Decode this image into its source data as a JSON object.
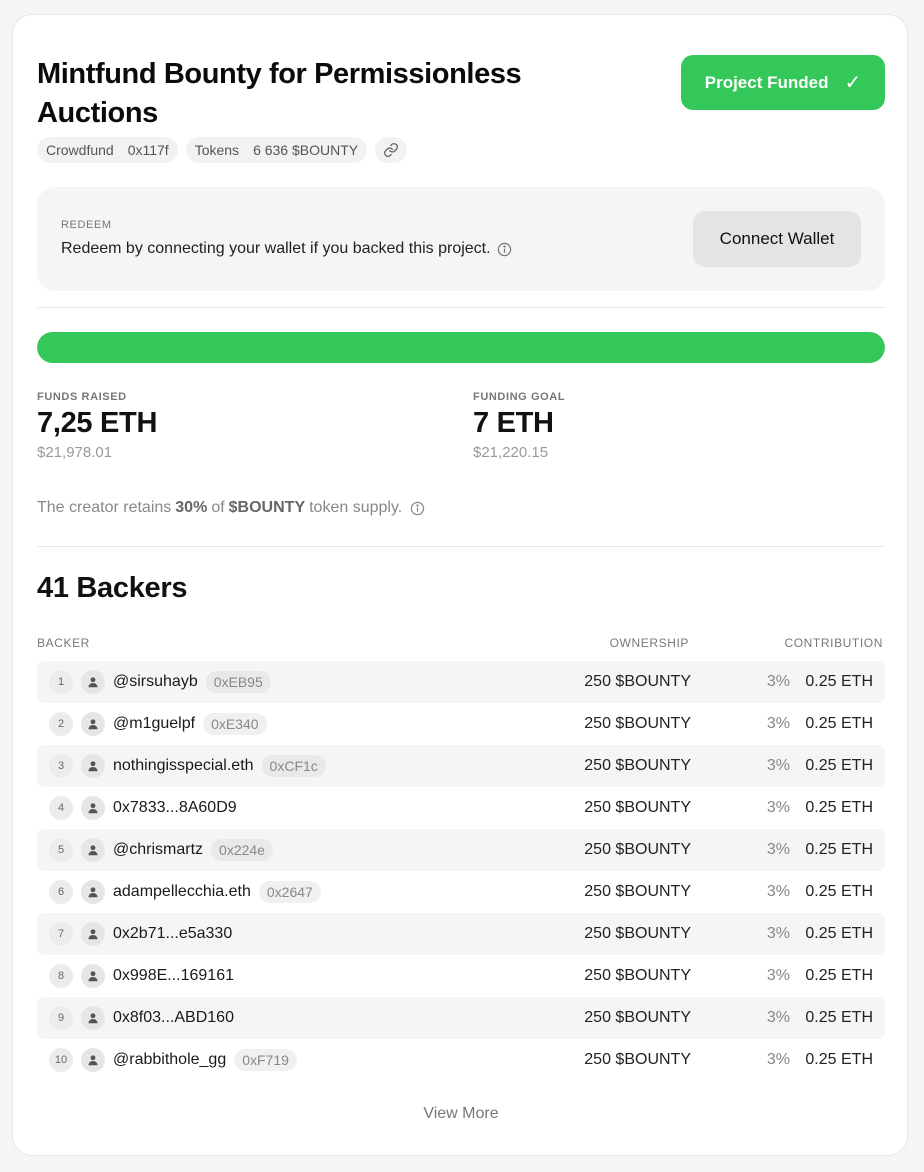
{
  "project": {
    "title": "Mintfund Bounty for Permissionless Auctions",
    "status_label": "Project Funded",
    "chips": {
      "type": "Crowdfund",
      "address": "0x117f",
      "tokens_label": "Tokens",
      "tokens_value": "6 636 $BOUNTY"
    }
  },
  "redeem": {
    "label": "REDEEM",
    "text": "Redeem by connecting your wallet if you backed this project.",
    "button": "Connect Wallet"
  },
  "funding": {
    "progress": 1.0,
    "raised_label": "FUNDS RAISED",
    "raised_value": "7,25 ETH",
    "raised_usd": "$21,978.01",
    "goal_label": "FUNDING GOAL",
    "goal_value": "7 ETH",
    "goal_usd": "$21,220.15",
    "retain_prefix": "The creator retains",
    "retain_pct": "30%",
    "retain_of": "of",
    "retain_token": "$BOUNTY",
    "retain_suffix": "token supply."
  },
  "backers": {
    "title": "41 Backers",
    "headers": {
      "backer": "BACKER",
      "ownership": "OWNERSHIP",
      "contribution": "CONTRIBUTION"
    },
    "rows": [
      {
        "rank": "1",
        "name": "@sirsuhayb",
        "address": "0xEB95",
        "ownership": "250 $BOUNTY",
        "pct": "3%",
        "contribution": "0.25 ETH"
      },
      {
        "rank": "2",
        "name": "@m1guelpf",
        "address": "0xE340",
        "ownership": "250 $BOUNTY",
        "pct": "3%",
        "contribution": "0.25 ETH"
      },
      {
        "rank": "3",
        "name": "nothingisspecial.eth",
        "address": "0xCF1c",
        "ownership": "250 $BOUNTY",
        "pct": "3%",
        "contribution": "0.25 ETH"
      },
      {
        "rank": "4",
        "name": "0x7833...8A60D9",
        "address": "",
        "ownership": "250 $BOUNTY",
        "pct": "3%",
        "contribution": "0.25 ETH"
      },
      {
        "rank": "5",
        "name": "@chrismartz",
        "address": "0x224e",
        "ownership": "250 $BOUNTY",
        "pct": "3%",
        "contribution": "0.25 ETH"
      },
      {
        "rank": "6",
        "name": "adampellecchia.eth",
        "address": "0x2647",
        "ownership": "250 $BOUNTY",
        "pct": "3%",
        "contribution": "0.25 ETH"
      },
      {
        "rank": "7",
        "name": "0x2b71...e5a330",
        "address": "",
        "ownership": "250 $BOUNTY",
        "pct": "3%",
        "contribution": "0.25 ETH"
      },
      {
        "rank": "8",
        "name": "0x998E...169161",
        "address": "",
        "ownership": "250 $BOUNTY",
        "pct": "3%",
        "contribution": "0.25 ETH"
      },
      {
        "rank": "9",
        "name": "0x8f03...ABD160",
        "address": "",
        "ownership": "250 $BOUNTY",
        "pct": "3%",
        "contribution": "0.25 ETH"
      },
      {
        "rank": "10",
        "name": "@rabbithole_gg",
        "address": "0xF719",
        "ownership": "250 $BOUNTY",
        "pct": "3%",
        "contribution": "0.25 ETH"
      }
    ],
    "view_more": "View More"
  },
  "colors": {
    "accent": "#34c759"
  },
  "icons": {
    "status": "check-icon",
    "link": "link-icon",
    "info": "info-icon",
    "avatar": "user-icon"
  }
}
